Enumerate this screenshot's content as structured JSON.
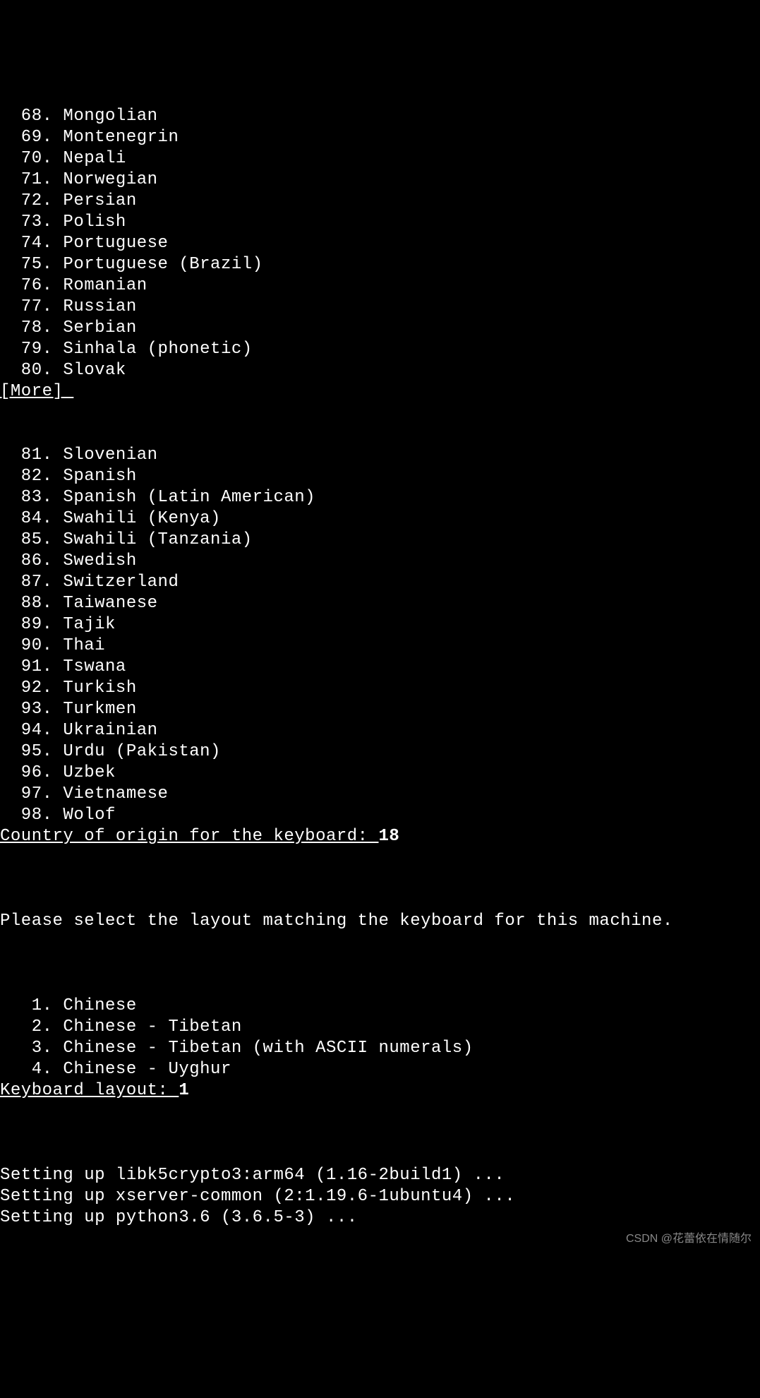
{
  "langlist1": [
    {
      "num": "68",
      "name": "Mongolian"
    },
    {
      "num": "69",
      "name": "Montenegrin"
    },
    {
      "num": "70",
      "name": "Nepali"
    },
    {
      "num": "71",
      "name": "Norwegian"
    },
    {
      "num": "72",
      "name": "Persian"
    },
    {
      "num": "73",
      "name": "Polish"
    },
    {
      "num": "74",
      "name": "Portuguese"
    },
    {
      "num": "75",
      "name": "Portuguese (Brazil)"
    },
    {
      "num": "76",
      "name": "Romanian"
    },
    {
      "num": "77",
      "name": "Russian"
    },
    {
      "num": "78",
      "name": "Serbian"
    },
    {
      "num": "79",
      "name": "Sinhala (phonetic)"
    },
    {
      "num": "80",
      "name": "Slovak"
    }
  ],
  "more_label": "[More] ",
  "langlist2": [
    {
      "num": "81",
      "name": "Slovenian"
    },
    {
      "num": "82",
      "name": "Spanish"
    },
    {
      "num": "83",
      "name": "Spanish (Latin American)"
    },
    {
      "num": "84",
      "name": "Swahili (Kenya)"
    },
    {
      "num": "85",
      "name": "Swahili (Tanzania)"
    },
    {
      "num": "86",
      "name": "Swedish"
    },
    {
      "num": "87",
      "name": "Switzerland"
    },
    {
      "num": "88",
      "name": "Taiwanese"
    },
    {
      "num": "89",
      "name": "Tajik"
    },
    {
      "num": "90",
      "name": "Thai"
    },
    {
      "num": "91",
      "name": "Tswana"
    },
    {
      "num": "92",
      "name": "Turkish"
    },
    {
      "num": "93",
      "name": "Turkmen"
    },
    {
      "num": "94",
      "name": "Ukrainian"
    },
    {
      "num": "95",
      "name": "Urdu (Pakistan)"
    },
    {
      "num": "96",
      "name": "Uzbek"
    },
    {
      "num": "97",
      "name": "Vietnamese"
    },
    {
      "num": "98",
      "name": "Wolof"
    }
  ],
  "prompt1_label": "Country of origin for the keyboard: ",
  "prompt1_value": "18",
  "instruction": "Please select the layout matching the keyboard for this machine.",
  "layoutlist": [
    {
      "num": "1",
      "name": "Chinese"
    },
    {
      "num": "2",
      "name": "Chinese - Tibetan"
    },
    {
      "num": "3",
      "name": "Chinese - Tibetan (with ASCII numerals)"
    },
    {
      "num": "4",
      "name": "Chinese - Uyghur"
    }
  ],
  "prompt2_label": "Keyboard layout: ",
  "prompt2_value": "1",
  "setup_lines": [
    "Setting up libk5crypto3:arm64 (1.16-2build1) ...",
    "Setting up xserver-common (2:1.19.6-1ubuntu4) ...",
    "Setting up python3.6 (3.6.5-3) ..."
  ],
  "watermark": "CSDN @花蕾依在情随尔"
}
